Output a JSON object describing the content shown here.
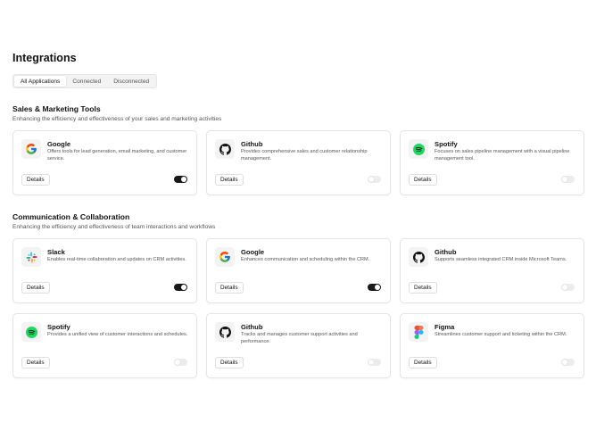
{
  "page": {
    "title": "Integrations"
  },
  "tabs": [
    {
      "label": "All Applications",
      "active": true
    },
    {
      "label": "Connected",
      "active": false
    },
    {
      "label": "Disconnected",
      "active": false
    }
  ],
  "sections": [
    {
      "title": "Sales & Marketing Tools",
      "subtitle": "Enhancing the efficiency and effectiveness of your sales and marketing activities",
      "cards": [
        {
          "name": "Google",
          "icon": "google-icon",
          "description": "Offers tools for lead generation, email marketing, and customer service.",
          "details_label": "Details",
          "connected": true
        },
        {
          "name": "Github",
          "icon": "github-icon",
          "description": "Provides comprehensive sales and customer relationship management.",
          "details_label": "Details",
          "connected": false
        },
        {
          "name": "Spotify",
          "icon": "spotify-icon",
          "description": "Focuses on sales pipeline management with a visual pipeline management tool.",
          "details_label": "Details",
          "connected": false
        }
      ]
    },
    {
      "title": "Communication & Collaboration",
      "subtitle": "Enhancing the efficiency and effectiveness of team interactions and workflows",
      "cards": [
        {
          "name": "Slack",
          "icon": "slack-icon",
          "description": "Enables real-time collaboration and updates on CRM activities.",
          "details_label": "Details",
          "connected": true
        },
        {
          "name": "Google",
          "icon": "google-icon",
          "description": "Enhances communication and scheduling within the CRM.",
          "details_label": "Details",
          "connected": true
        },
        {
          "name": "Github",
          "icon": "github-icon",
          "description": "Supports seamless integrated CRM inside Microsoft Teams.",
          "details_label": "Details",
          "connected": false
        },
        {
          "name": "Spotify",
          "icon": "spotify-icon",
          "description": "Provides a unified view of customer interactions and schedules.",
          "details_label": "Details",
          "connected": false
        },
        {
          "name": "Github",
          "icon": "github-icon",
          "description": "Tracks and manages customer support activities and performance.",
          "details_label": "Details",
          "connected": false
        },
        {
          "name": "Figma",
          "icon": "figma-icon",
          "description": "Streamlines customer support and ticketing within the CRM.",
          "details_label": "Details",
          "connected": false
        }
      ]
    }
  ],
  "colors": {
    "toggle_on": "#18181b",
    "toggle_off": "#ececee",
    "card_border": "#e4e4e7",
    "spotify": "#1ed760"
  }
}
